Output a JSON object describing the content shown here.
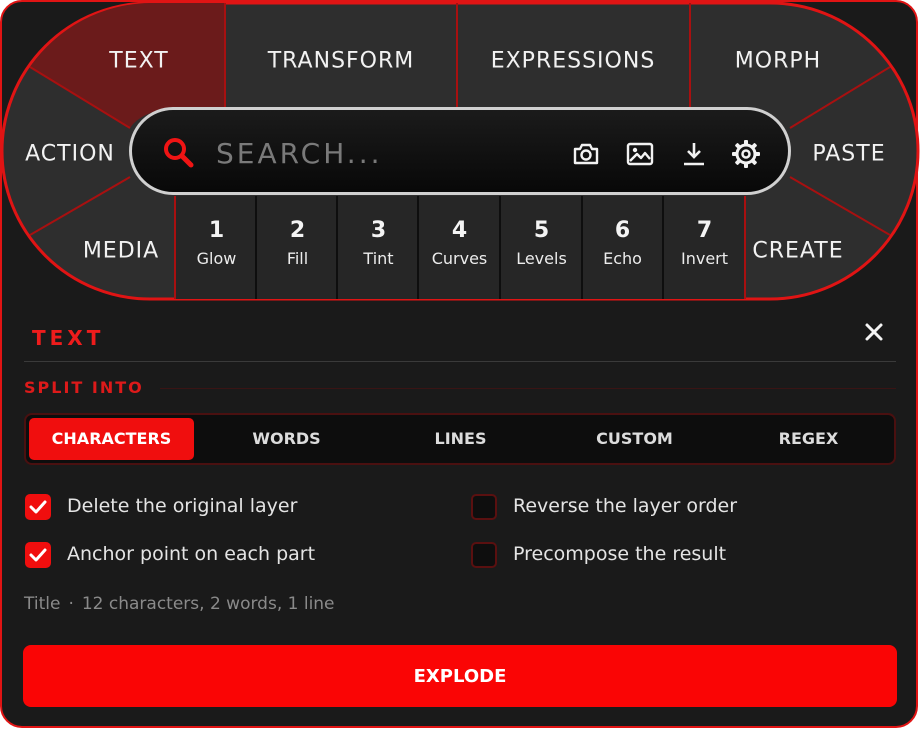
{
  "wheel": {
    "segments": {
      "text": "TEXT",
      "transform": "TRANSFORM",
      "expressions": "EXPRESSIONS",
      "morph": "MORPH",
      "action": "ACTION",
      "paste": "PASTE",
      "media": "MEDIA",
      "create": "CREATE"
    },
    "active_segment": "text",
    "slots": [
      {
        "num": "1",
        "name": "Glow"
      },
      {
        "num": "2",
        "name": "Fill"
      },
      {
        "num": "3",
        "name": "Tint"
      },
      {
        "num": "4",
        "name": "Curves"
      },
      {
        "num": "5",
        "name": "Levels"
      },
      {
        "num": "6",
        "name": "Echo"
      },
      {
        "num": "7",
        "name": "Invert"
      }
    ]
  },
  "search": {
    "placeholder": "SEARCH...",
    "value": "",
    "tools": [
      "camera-icon",
      "image-icon",
      "download-icon",
      "gear-icon"
    ]
  },
  "section": {
    "title": "TEXT",
    "split_label": "SPLIT INTO",
    "tabs": [
      "CHARACTERS",
      "WORDS",
      "LINES",
      "CUSTOM",
      "REGEX"
    ],
    "active_tab": "CHARACTERS"
  },
  "options": [
    {
      "label": "Delete the original layer",
      "checked": true
    },
    {
      "label": "Reverse the layer order",
      "checked": false
    },
    {
      "label": "Anchor point on each part",
      "checked": true
    },
    {
      "label": "Precompose the result",
      "checked": false
    }
  ],
  "info": {
    "layer": "Title",
    "separator": "·",
    "stats": "12 characters, 2 words, 1 line"
  },
  "explode_label": "EXPLODE",
  "colors": {
    "accent": "#f00e0e",
    "panel": "#1a1a1a",
    "segment": "#303030",
    "segment_active": "#6a1a1a"
  }
}
